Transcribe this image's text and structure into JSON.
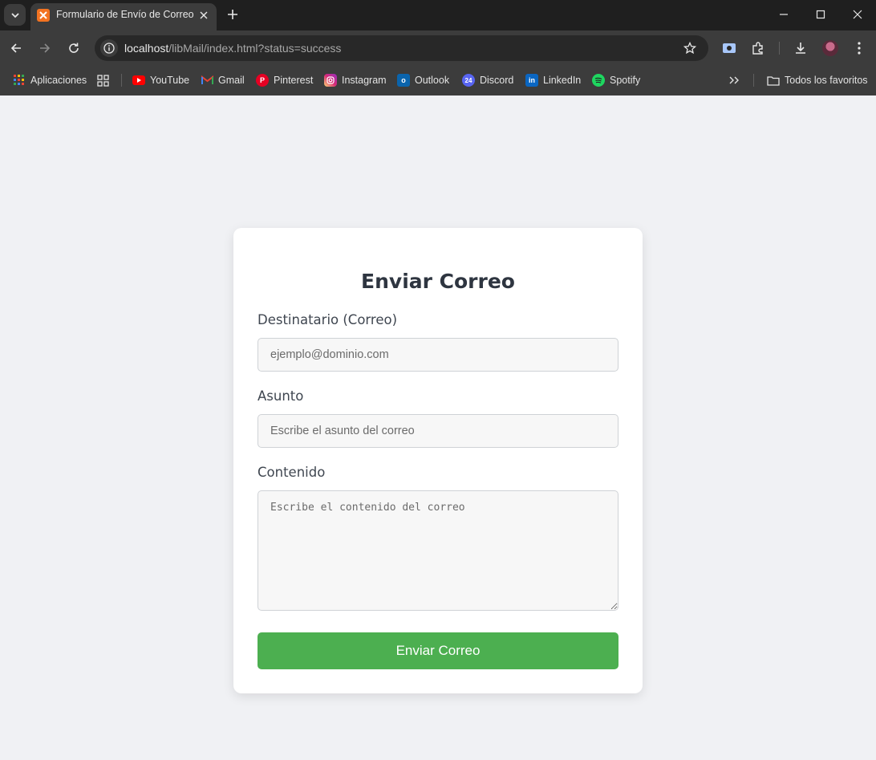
{
  "browser": {
    "tab": {
      "title": "Formulario de Envío de Correo",
      "favicon": "xampp-icon"
    },
    "url": {
      "host": "localhost",
      "path": "/libMail/index.html?status=success"
    },
    "bookmarks": [
      {
        "label": "Aplicaciones",
        "icon": "apps-grid-icon"
      },
      {
        "label": "YouTube",
        "icon": "youtube-icon"
      },
      {
        "label": "Gmail",
        "icon": "gmail-icon"
      },
      {
        "label": "Pinterest",
        "icon": "pinterest-icon"
      },
      {
        "label": "Instagram",
        "icon": "instagram-icon"
      },
      {
        "label": "Outlook",
        "icon": "outlook-icon"
      },
      {
        "label": "Discord",
        "icon": "discord-icon"
      },
      {
        "label": "LinkedIn",
        "icon": "linkedin-icon"
      },
      {
        "label": "Spotify",
        "icon": "spotify-icon"
      }
    ],
    "all_bookmarks_label": "Todos los favoritos",
    "colors": {
      "tabbar": "#1f1f1f",
      "toolbar": "#3c3c3c",
      "omnibox": "#282828"
    }
  },
  "form": {
    "title": "Enviar Correo",
    "recipient": {
      "label": "Destinatario (Correo)",
      "placeholder": "ejemplo@dominio.com",
      "value": ""
    },
    "subject": {
      "label": "Asunto",
      "placeholder": "Escribe el asunto del correo",
      "value": ""
    },
    "content": {
      "label": "Contenido",
      "placeholder": "Escribe el contenido del correo",
      "value": ""
    },
    "submit_label": "Enviar Correo",
    "colors": {
      "submit": "#4caf50",
      "background": "#f0f1f4",
      "card": "#ffffff"
    }
  }
}
